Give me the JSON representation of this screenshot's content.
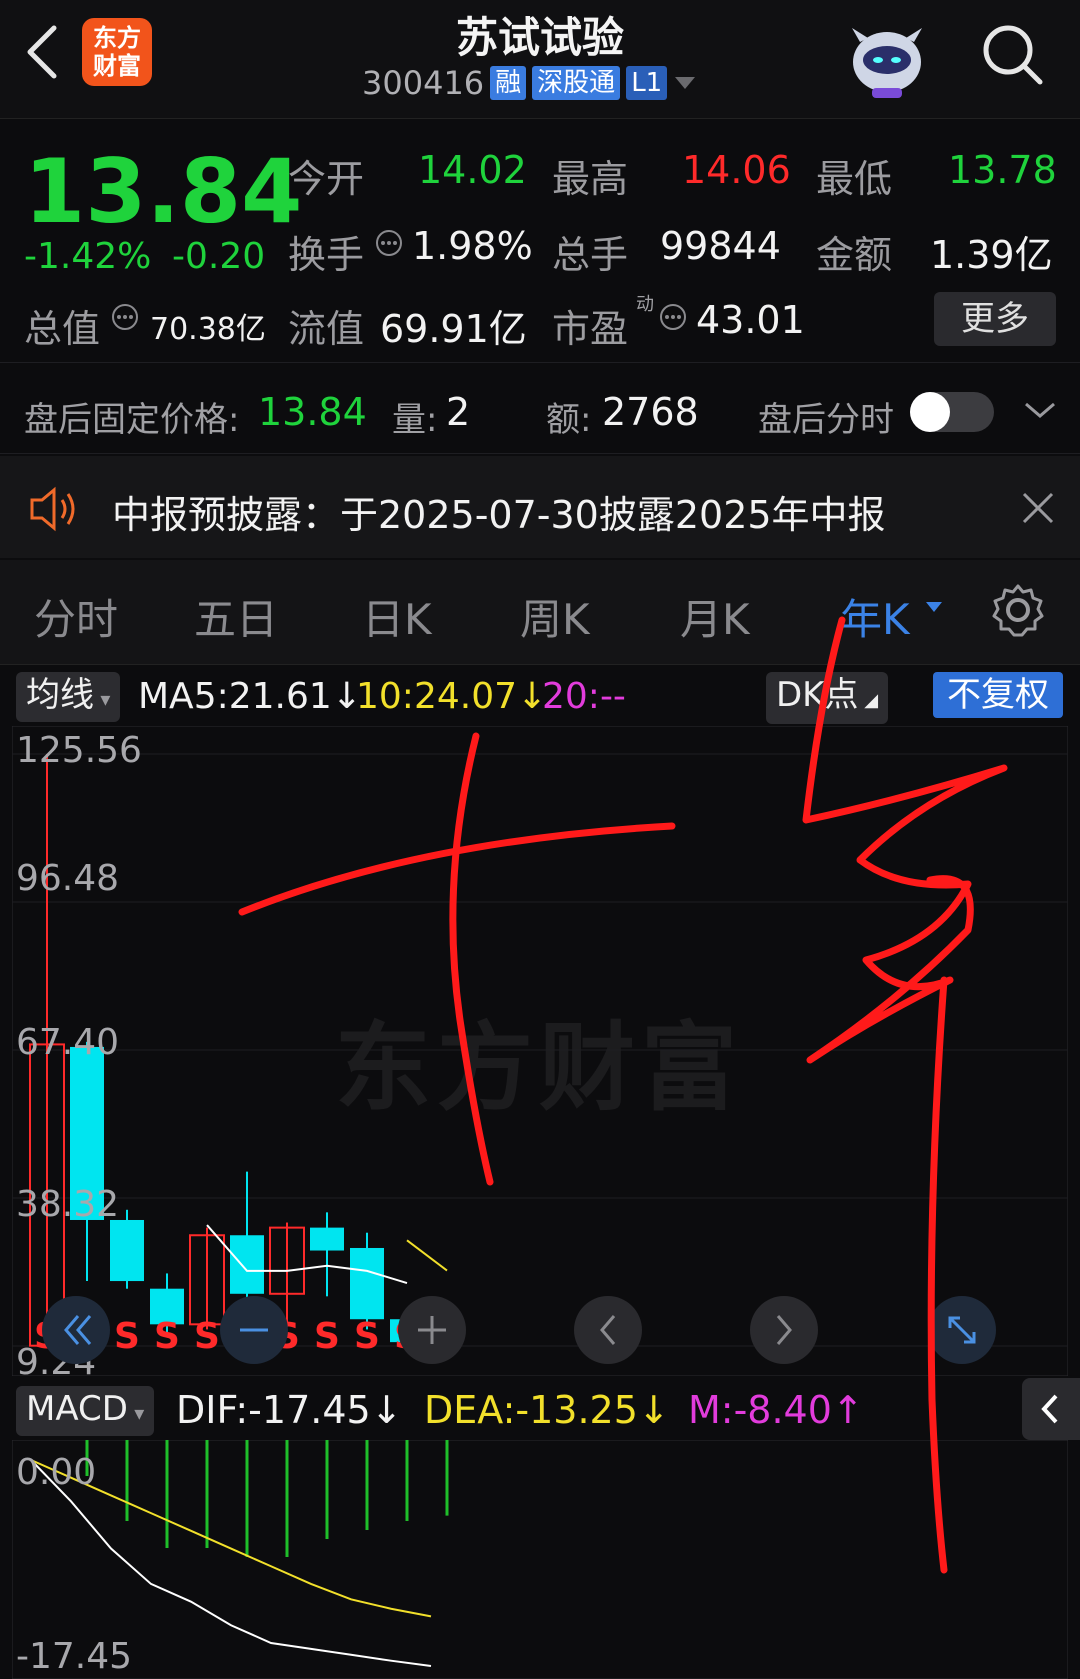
{
  "header": {
    "logo_line1": "东方",
    "logo_line2": "财富",
    "title": "苏试试验",
    "code": "300416",
    "tags": [
      "融",
      "深股通",
      "L1"
    ]
  },
  "quote": {
    "price": "13.84",
    "change_pct": "-1.42%",
    "change": "-0.20",
    "labels": {
      "open": "今开",
      "high": "最高",
      "low": "最低",
      "turnover": "换手",
      "volume": "总手",
      "amount": "金额",
      "total_value": "总值",
      "float_value": "流值",
      "pe": "市盈",
      "pe_super": "动"
    },
    "open": "14.02",
    "high": "14.06",
    "low": "13.78",
    "turnover": "1.98%",
    "volume": "99844",
    "amount": "1.39亿",
    "total_value": "70.38亿",
    "float_value": "69.91亿",
    "pe": "43.01",
    "more": "更多"
  },
  "after_hours": {
    "label": "盘后固定价格:",
    "price": "13.84",
    "vol_label": "量:",
    "vol": "2",
    "amt_label": "额:",
    "amt": "2768",
    "toggle_label": "盘后分时"
  },
  "notice": {
    "text": "中报预披露：于2025-07-30披露2025年中报"
  },
  "tabs": [
    "分时",
    "五日",
    "日K",
    "周K",
    "月K",
    "年K"
  ],
  "chart_header": {
    "ma_select": "均线",
    "ma5": "MA5:21.61↓",
    "ma10": "10:24.07↓",
    "ma20": "20:--",
    "dk": "DK点",
    "fq": "不复权"
  },
  "watermark": "东方财富",
  "macd_header": {
    "select": "MACD",
    "dif": "DIF:-17.45↓",
    "dea": "DEA:-13.25↓",
    "m": "M:-8.40↑"
  },
  "colors": {
    "up": "#ff2a2a",
    "down": "#00e5f0",
    "accent": "#3b82e6",
    "ma5": "#ffffff",
    "ma10": "#f2e02b",
    "ma20": "#e23cdc"
  },
  "chart_data": [
    {
      "type": "candlestick",
      "y_ticks": [
        "125.56",
        "96.48",
        "67.40",
        "38.32",
        "9.24"
      ],
      "ylim": [
        9.24,
        125.56
      ],
      "candles": [
        {
          "open": 9.3,
          "close": 68.5,
          "high": 125.56,
          "low": 9.24
        },
        {
          "open": 68.0,
          "close": 34.0,
          "high": 69.0,
          "low": 22.0
        },
        {
          "open": 34.0,
          "close": 22.0,
          "high": 36.0,
          "low": 20.5
        },
        {
          "open": 20.5,
          "close": 13.5,
          "high": 23.5,
          "low": 12.0
        },
        {
          "open": 13.5,
          "close": 31.0,
          "high": 32.5,
          "low": 12.5
        },
        {
          "open": 31.0,
          "close": 19.5,
          "high": 43.5,
          "low": 13.0
        },
        {
          "open": 19.5,
          "close": 32.5,
          "high": 33.5,
          "low": 13.0
        },
        {
          "open": 32.5,
          "close": 28.0,
          "high": 35.5,
          "low": 19.0
        },
        {
          "open": 28.5,
          "close": 14.5,
          "high": 31.5,
          "low": 12.5
        },
        {
          "open": 14.5,
          "close": 10.0,
          "high": 16.5,
          "low": 9.4
        },
        {
          "open": 13.9,
          "close": 13.8,
          "high": 14.1,
          "low": 13.7
        }
      ],
      "ma5": [
        null,
        null,
        null,
        null,
        33.0,
        24.0,
        24.0,
        25.0,
        24.0,
        21.61
      ],
      "ma10": [
        null,
        null,
        null,
        null,
        null,
        null,
        null,
        null,
        null,
        30.0,
        24.07
      ],
      "signals": [
        "S",
        "S",
        "S",
        "S",
        "S",
        "S",
        "S",
        "S",
        "S",
        "S",
        "S"
      ]
    },
    {
      "type": "macd",
      "y_ticks": [
        "0.00",
        "-17.45"
      ],
      "dif": [
        0.0,
        -3.5,
        -7.5,
        -10.5,
        -12.0,
        -14.0,
        -15.5,
        -16.0,
        -16.5,
        -17.0,
        -17.45
      ],
      "dea": [
        0.0,
        -1.5,
        -3.0,
        -4.5,
        -6.0,
        -7.5,
        -9.0,
        -10.5,
        -11.8,
        -12.6,
        -13.25
      ],
      "m": [
        0.0,
        -4.0,
        -9.0,
        -12.0,
        -12.0,
        -13.0,
        -13.0,
        -11.0,
        -10.0,
        -9.0,
        -8.4
      ]
    }
  ]
}
